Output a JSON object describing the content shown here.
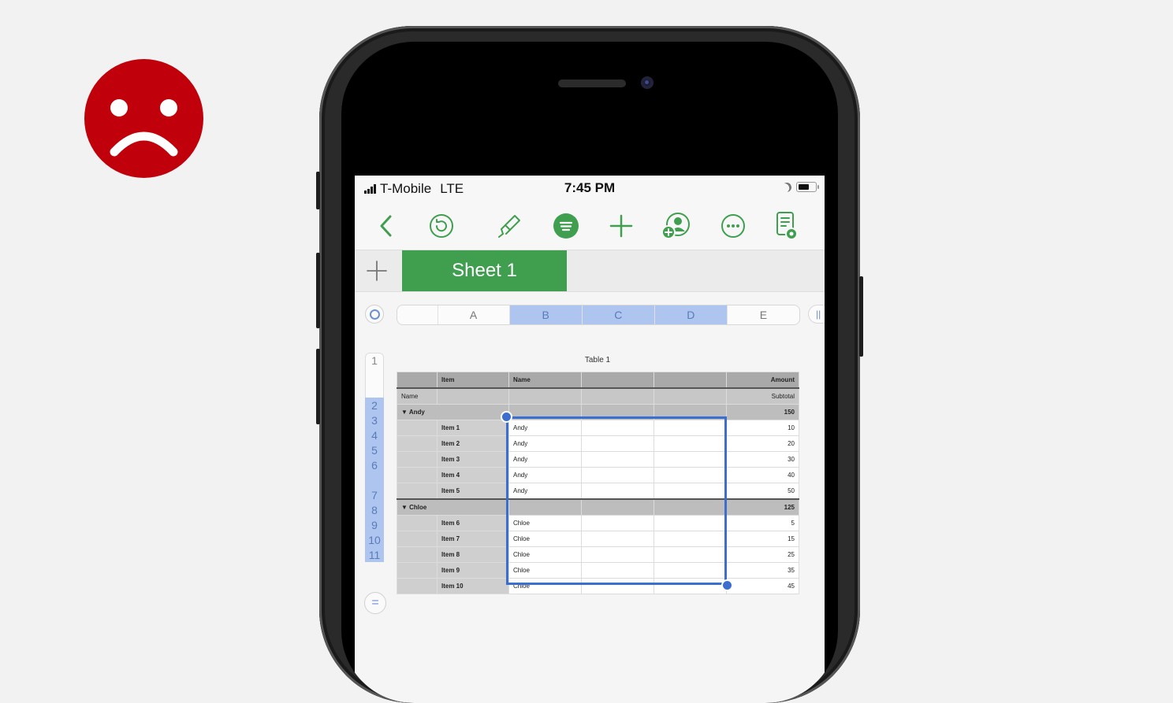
{
  "status_bar": {
    "carrier": "T-Mobile",
    "network": "LTE",
    "time": "7:45 PM"
  },
  "toolbar": {
    "icons": [
      "back-chevron-icon",
      "undo-icon",
      "paintbrush-icon",
      "format-icon",
      "add-icon",
      "collaborate-icon",
      "more-icon",
      "reader-view-icon"
    ]
  },
  "sheets": {
    "tabs": [
      "Sheet 1"
    ]
  },
  "columns": [
    "A",
    "B",
    "C",
    "D",
    "E"
  ],
  "selected_columns": [
    "B",
    "C",
    "D"
  ],
  "rows": [
    "1",
    "",
    "",
    "2",
    "3",
    "4",
    "5",
    "6",
    "",
    "7",
    "8",
    "9",
    "10",
    "11"
  ],
  "table": {
    "title": "Table 1",
    "headers": {
      "item": "Item",
      "name": "Name",
      "amount": "Amount"
    },
    "group_label": "Name",
    "subtotal_label": "Subtotal",
    "groups": [
      {
        "name": "▼ Andy",
        "subtotal": "150",
        "rows": [
          {
            "item": "Item 1",
            "name": "Andy",
            "amount": "10"
          },
          {
            "item": "Item 2",
            "name": "Andy",
            "amount": "20"
          },
          {
            "item": "Item 3",
            "name": "Andy",
            "amount": "30"
          },
          {
            "item": "Item 4",
            "name": "Andy",
            "amount": "40"
          },
          {
            "item": "Item 5",
            "name": "Andy",
            "amount": "50"
          }
        ]
      },
      {
        "name": "▼ Chloe",
        "subtotal": "125",
        "rows": [
          {
            "item": "Item 6",
            "name": "Chloe",
            "amount": "5"
          },
          {
            "item": "Item 7",
            "name": "Chloe",
            "amount": "15"
          },
          {
            "item": "Item 8",
            "name": "Chloe",
            "amount": "25"
          },
          {
            "item": "Item 9",
            "name": "Chloe",
            "amount": "35"
          },
          {
            "item": "Item 10",
            "name": "Chloe",
            "amount": "45"
          }
        ]
      }
    ]
  },
  "colors": {
    "accent_green": "#3f9f4f",
    "selection_blue": "#3c6ed0",
    "sad_red": "#c0000a"
  }
}
